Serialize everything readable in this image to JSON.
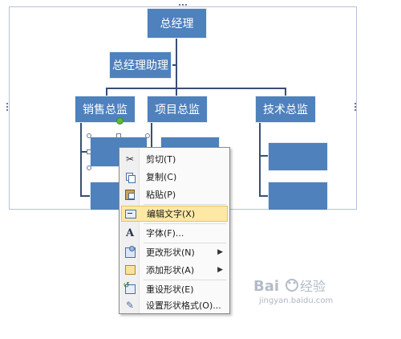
{
  "org_chart": {
    "top": "总经理",
    "assistant": "总经理助理",
    "departments": [
      "销售总监",
      "项目总监",
      "技术总监"
    ]
  },
  "context_menu": {
    "items": [
      {
        "label": "剪切(T)",
        "icon": "scissors-icon"
      },
      {
        "label": "复制(C)",
        "icon": "copy-icon"
      },
      {
        "label": "粘贴(P)",
        "icon": "paste-icon"
      },
      {
        "label": "编辑文字(X)",
        "icon": "edit-text-icon",
        "highlighted": true
      },
      {
        "label": "字体(F)...",
        "icon": "font-icon"
      },
      {
        "label": "更改形状(N)",
        "icon": "change-shape-icon",
        "submenu": true
      },
      {
        "label": "添加形状(A)",
        "icon": "add-shape-icon",
        "submenu": true
      },
      {
        "label": "重设形状(E)",
        "icon": "reset-shape-icon"
      },
      {
        "label": "设置形状格式(O)...",
        "icon": "format-shape-icon"
      }
    ]
  },
  "colors": {
    "box_fill": "#4f81bd",
    "menu_highlight": "#fde8a6"
  }
}
